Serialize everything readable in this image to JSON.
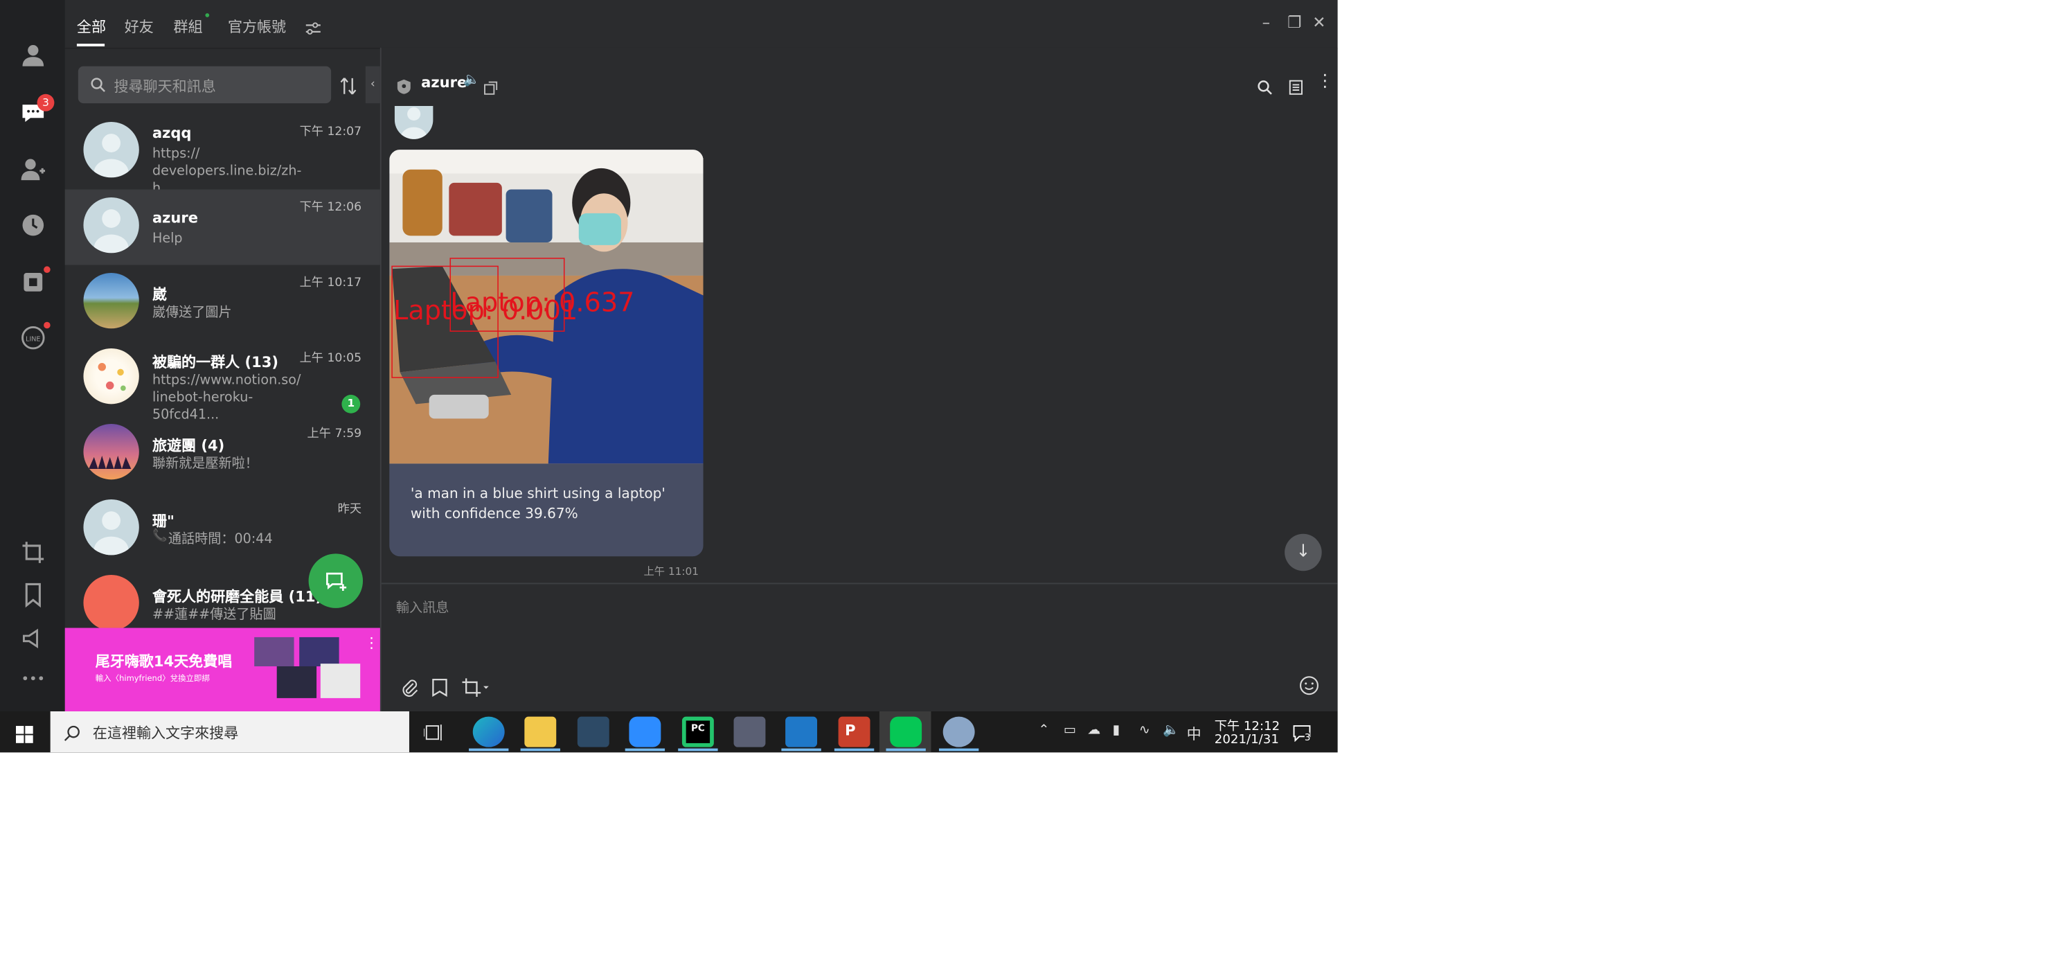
{
  "tabs": {
    "all": "全部",
    "friends": "好友",
    "groups": "群組",
    "official": "官方帳號"
  },
  "search": {
    "placeholder": "搜尋聊天和訊息"
  },
  "rail": {
    "chat_badge": "3"
  },
  "chats": [
    {
      "name": "azqq",
      "time": "下午 12:07",
      "preview": "https://\ndevelopers.line.biz/zh-h..."
    },
    {
      "name": "azure",
      "time": "下午 12:06",
      "preview": "Help"
    },
    {
      "name": "崴",
      "time": "上午 10:17",
      "preview": "崴傳送了圖片"
    },
    {
      "name": "被騙的一群人 (13)",
      "time": "上午 10:05",
      "preview": "https://www.notion.so/\nlinebot-heroku-50fcd41...",
      "unread": "1"
    },
    {
      "name": "旅遊團 (4)",
      "time": "上午 7:59",
      "preview": "聯新就是壓新啦！"
    },
    {
      "name": "珊\"",
      "time": "昨天",
      "preview": "通話時間：00:44"
    },
    {
      "name": "會死人的研磨全能員 (11)",
      "time": "",
      "preview": "##蓮##傳送了貼圖"
    }
  ],
  "ad": {
    "title": "尾牙嗨歌14天免費唱",
    "sub": "輸入〈himyfriend〉兌換立即綁"
  },
  "chat": {
    "title": "azure",
    "detections": [
      {
        "label": "Laptop: 0.637"
      },
      {
        "label": "Laptop: 0.001"
      }
    ],
    "caption": "'a man in a blue shirt using a laptop' with confidence 39.67%",
    "message_time": "上午 11:01",
    "input_placeholder": "輸入訊息"
  },
  "taskbar": {
    "search_placeholder": "在這裡輸入文字來搜尋",
    "ime": "中",
    "time": "下午 12:12",
    "date": "2021/1/31",
    "notif_count": "3"
  },
  "colors": {
    "accent_green": "#33a94f",
    "badge_red": "#e94141",
    "bubble_bg": "#474d63",
    "ad_pink": "#f03ad6",
    "detect_red": "#e3141d"
  }
}
